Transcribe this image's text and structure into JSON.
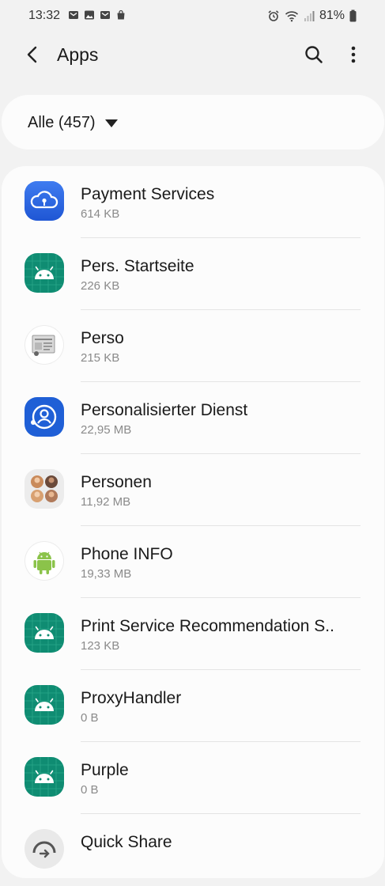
{
  "status_bar": {
    "time": "13:32",
    "battery": "81%"
  },
  "app_bar": {
    "title": "Apps"
  },
  "filter": {
    "label": "Alle (457)"
  },
  "apps": [
    {
      "name": "Payment Services",
      "size": "614 KB",
      "icon": "cloud-key-icon"
    },
    {
      "name": "Pers. Startseite",
      "size": "226 KB",
      "icon": "android-icon"
    },
    {
      "name": "Perso",
      "size": "215 KB",
      "icon": "id-card-icon"
    },
    {
      "name": "Personalisierter Dienst",
      "size": "22,95 MB",
      "icon": "person-service-icon"
    },
    {
      "name": "Personen",
      "size": "11,92 MB",
      "icon": "people-icon"
    },
    {
      "name": "Phone INFO",
      "size": "19,33 MB",
      "icon": "android-green-icon"
    },
    {
      "name": "Print Service Recommendation S..",
      "size": "123 KB",
      "icon": "android-icon"
    },
    {
      "name": "ProxyHandler",
      "size": "0 B",
      "icon": "android-icon"
    },
    {
      "name": "Purple",
      "size": "0 B",
      "icon": "android-icon"
    },
    {
      "name": "Quick Share",
      "size": "",
      "icon": "quick-share-icon"
    }
  ],
  "colors": {
    "background": "#f2f2f2",
    "card": "#fcfcfc",
    "android_teal": "#0f8c72",
    "samsung_blue": "#1f5fd6"
  }
}
